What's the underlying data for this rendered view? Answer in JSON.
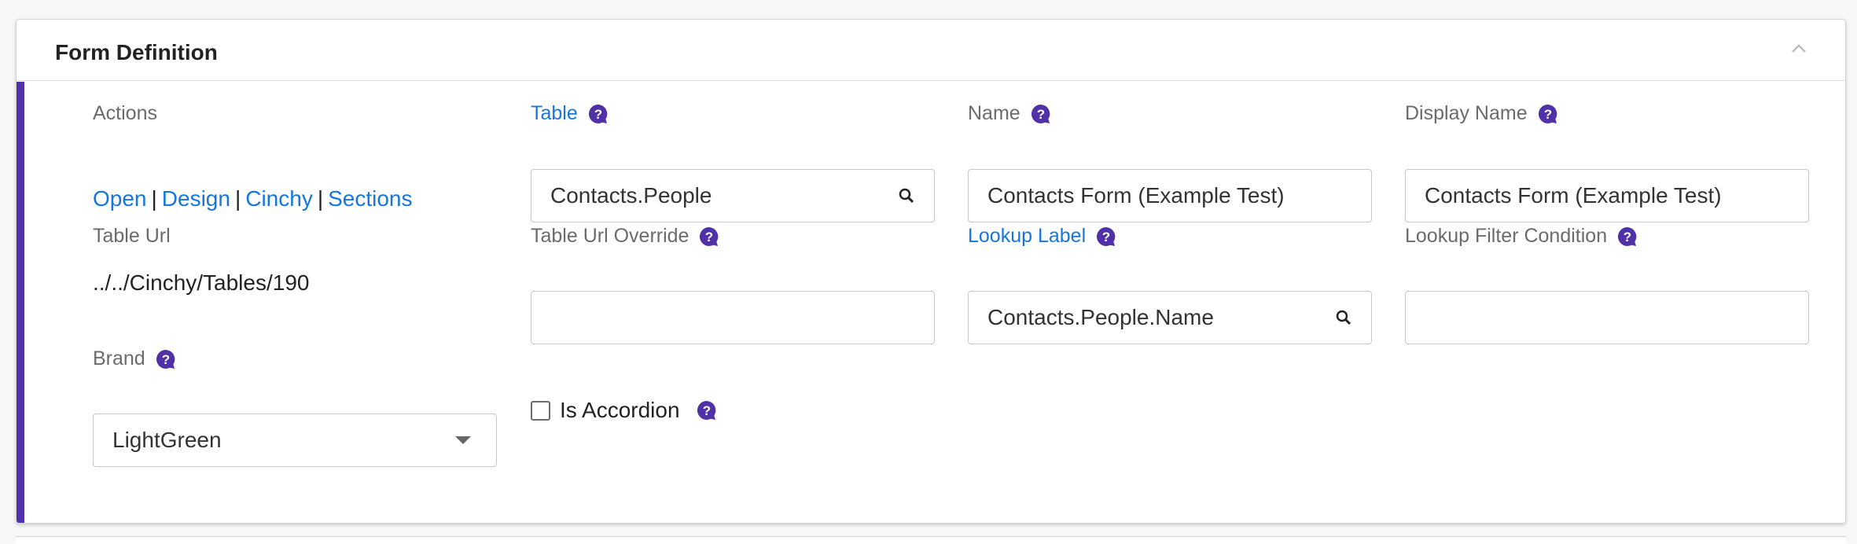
{
  "panel": {
    "title": "Form Definition",
    "accent_color": "#5131a8",
    "link_color": "#1676e0"
  },
  "actions": {
    "label": "Actions",
    "links": [
      "Open",
      "Design",
      "Cinchy",
      "Sections"
    ],
    "separator": "|"
  },
  "table": {
    "label": "Table",
    "value": "Contacts.People"
  },
  "name": {
    "label": "Name",
    "value": "Contacts Form (Example Test)"
  },
  "display_name": {
    "label": "Display Name",
    "value": "Contacts Form (Example Test)"
  },
  "table_url": {
    "label": "Table Url",
    "value": "../../Cinchy/Tables/190"
  },
  "table_url_override": {
    "label": "Table Url Override",
    "value": ""
  },
  "lookup_label": {
    "label": "Lookup Label",
    "value": "Contacts.People.Name"
  },
  "lookup_filter": {
    "label": "Lookup Filter Condition",
    "value": ""
  },
  "brand": {
    "label": "Brand",
    "value": "LightGreen"
  },
  "accordion": {
    "label": "Is Accordion",
    "checked": false
  },
  "icons": {
    "help": "help-bubble-icon",
    "search": "search-icon",
    "collapse": "chevron-up-icon",
    "dropdown": "caret-down-icon"
  }
}
